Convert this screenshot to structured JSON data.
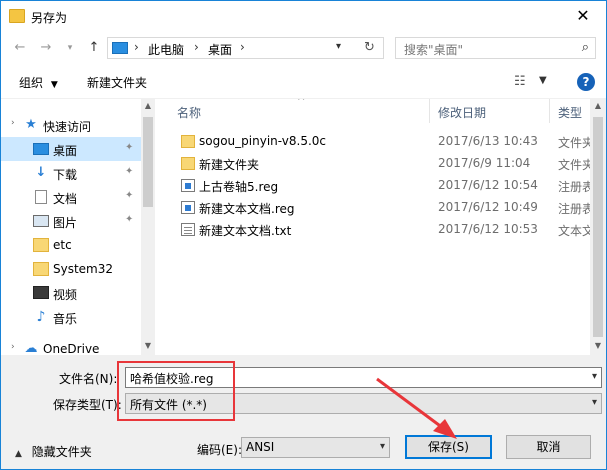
{
  "window": {
    "title": "另存为",
    "close_label": "✕"
  },
  "nav": {
    "breadcrumb": [
      "此电脑",
      "桌面"
    ],
    "search_placeholder": "搜索\"桌面\""
  },
  "toolbar": {
    "organize_label": "组织",
    "new_folder_label": "新建文件夹"
  },
  "sidebar": {
    "items": [
      {
        "label": "快速访问",
        "icon": "star-icon"
      },
      {
        "label": "桌面",
        "icon": "desktop-icon",
        "selected": true,
        "pinned": true
      },
      {
        "label": "下载",
        "icon": "download-icon",
        "pinned": true
      },
      {
        "label": "文档",
        "icon": "document-icon",
        "pinned": true
      },
      {
        "label": "图片",
        "icon": "picture-icon",
        "pinned": true
      },
      {
        "label": "etc",
        "icon": "folder-icon"
      },
      {
        "label": "System32",
        "icon": "folder-icon"
      },
      {
        "label": "视频",
        "icon": "video-icon"
      },
      {
        "label": "音乐",
        "icon": "music-icon"
      },
      {
        "label": "OneDrive",
        "icon": "cloud-icon"
      }
    ]
  },
  "files": {
    "columns": {
      "name": "名称",
      "date": "修改日期",
      "type": "类型"
    },
    "rows": [
      {
        "name": "sogou_pinyin-v8.5.0c",
        "date": "2017/6/13 10:43",
        "type": "文件夹",
        "icon": "folder-icon"
      },
      {
        "name": "新建文件夹",
        "date": "2017/6/9 11:04",
        "type": "文件夹",
        "icon": "folder-icon"
      },
      {
        "name": "上古卷轴5.reg",
        "date": "2017/6/12 10:54",
        "type": "注册表项",
        "icon": "reg-file-icon"
      },
      {
        "name": "新建文本文档.reg",
        "date": "2017/6/12 10:49",
        "type": "注册表项",
        "icon": "reg-file-icon"
      },
      {
        "name": "新建文本文档.txt",
        "date": "2017/6/12 10:53",
        "type": "文本文档",
        "icon": "txt-file-icon"
      }
    ]
  },
  "form": {
    "filename_label": "文件名(N):",
    "filename_value": "哈希值校验.reg",
    "type_label": "保存类型(T):",
    "type_value": "所有文件 (*.*)",
    "encoding_label": "编码(E):",
    "encoding_value": "ANSI",
    "hide_folders_label": "隐藏文件夹",
    "save_label": "保存(S)",
    "cancel_label": "取消"
  },
  "colors": {
    "accent": "#0078d7",
    "highlight_box": "#e8363a",
    "selected": "#cce8ff"
  }
}
